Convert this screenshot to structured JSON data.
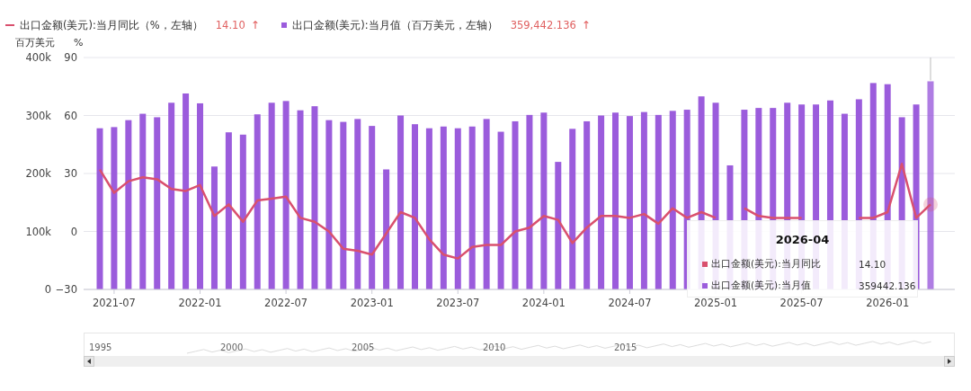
{
  "legend": [
    {
      "kind": "line",
      "label": "出口金额(美元):当月同比（%，左轴）",
      "value": "14.10",
      "arrow": "↑",
      "color": "#d9506e"
    },
    {
      "kind": "bar",
      "label": "出口金额(美元):当月值（百万美元，左轴）",
      "value": "359,442.136",
      "arrow": "↑",
      "color": "#9b5cdc"
    }
  ],
  "chart": {
    "unit_left": "百万美元",
    "unit_right": "%",
    "chart_data": {
      "type": "bar",
      "stacked": false,
      "categories": [
        null,
        "2021-07",
        null,
        null,
        null,
        null,
        null,
        "2022-01",
        null,
        null,
        null,
        null,
        null,
        "2022-07",
        null,
        null,
        null,
        null,
        null,
        "2023-01",
        null,
        null,
        null,
        null,
        null,
        "2023-07",
        null,
        null,
        null,
        null,
        null,
        "2024-01",
        null,
        null,
        null,
        null,
        null,
        "2024-07",
        null,
        null,
        null,
        null,
        null,
        "2025-01",
        null,
        null,
        null,
        null,
        null,
        "2025-07",
        null,
        null,
        null,
        null,
        null,
        "2026-01",
        null,
        null,
        null
      ],
      "series": [
        {
          "type": "line",
          "axis": "y2",
          "color": "#d9506e",
          "values": [
            32,
            20,
            26,
            28,
            27,
            22,
            21,
            24,
            8,
            14,
            5,
            16,
            17,
            18,
            7,
            5,
            0,
            -9,
            -10,
            -12,
            -1,
            10,
            7,
            -4,
            -12,
            -14,
            -8,
            -7,
            -7,
            0,
            2,
            8,
            6,
            -6,
            2,
            8,
            8,
            7,
            9,
            4,
            12,
            7,
            10,
            7,
            null,
            12,
            8,
            7,
            7,
            7,
            null,
            null,
            null,
            7,
            7,
            10,
            35,
            7,
            14
          ]
        },
        {
          "color": "#9b5cdc",
          "values": [
            278,
            280,
            292,
            303,
            297,
            322,
            338,
            321,
            212,
            271,
            267,
            302,
            322,
            325,
            309,
            316,
            292,
            289,
            294,
            282,
            207,
            300,
            285,
            278,
            281,
            278,
            281,
            294,
            272,
            290,
            301,
            305,
            220,
            277,
            290,
            300,
            305,
            299,
            306,
            301,
            308,
            310,
            333,
            322,
            214,
            310,
            313,
            313,
            322,
            319,
            319,
            326,
            303,
            328,
            356,
            354,
            297,
            319,
            359
          ]
        }
      ],
      "ylim": [
        0,
        400
      ],
      "yticks": [
        {
          "value": 0,
          "label": "0"
        },
        {
          "value": 100,
          "label": "100k"
        },
        {
          "value": 200,
          "label": "200k"
        },
        {
          "value": 300,
          "label": "300k"
        },
        {
          "value": 400,
          "label": "400k"
        }
      ],
      "y2lim": [
        -30,
        90
      ],
      "y2ticks": [
        {
          "value": -30,
          "label": "−30"
        },
        {
          "value": 0,
          "label": "0"
        },
        {
          "value": 30,
          "label": "30"
        },
        {
          "value": 60,
          "label": "60"
        },
        {
          "value": 90,
          "label": "90"
        }
      ],
      "grid": true
    },
    "tooltip": {
      "title": "2026-04",
      "rows": [
        {
          "label": "出口金额(美元):当月同比",
          "value": "14.10",
          "color": "#d9506e"
        },
        {
          "label": "出口金额(美元):当月值",
          "value": "359442.136",
          "color": "#9b5cdc"
        }
      ]
    }
  },
  "navigator": {
    "years": [
      "1995",
      "2000",
      "2005",
      "2010",
      "2015"
    ]
  }
}
